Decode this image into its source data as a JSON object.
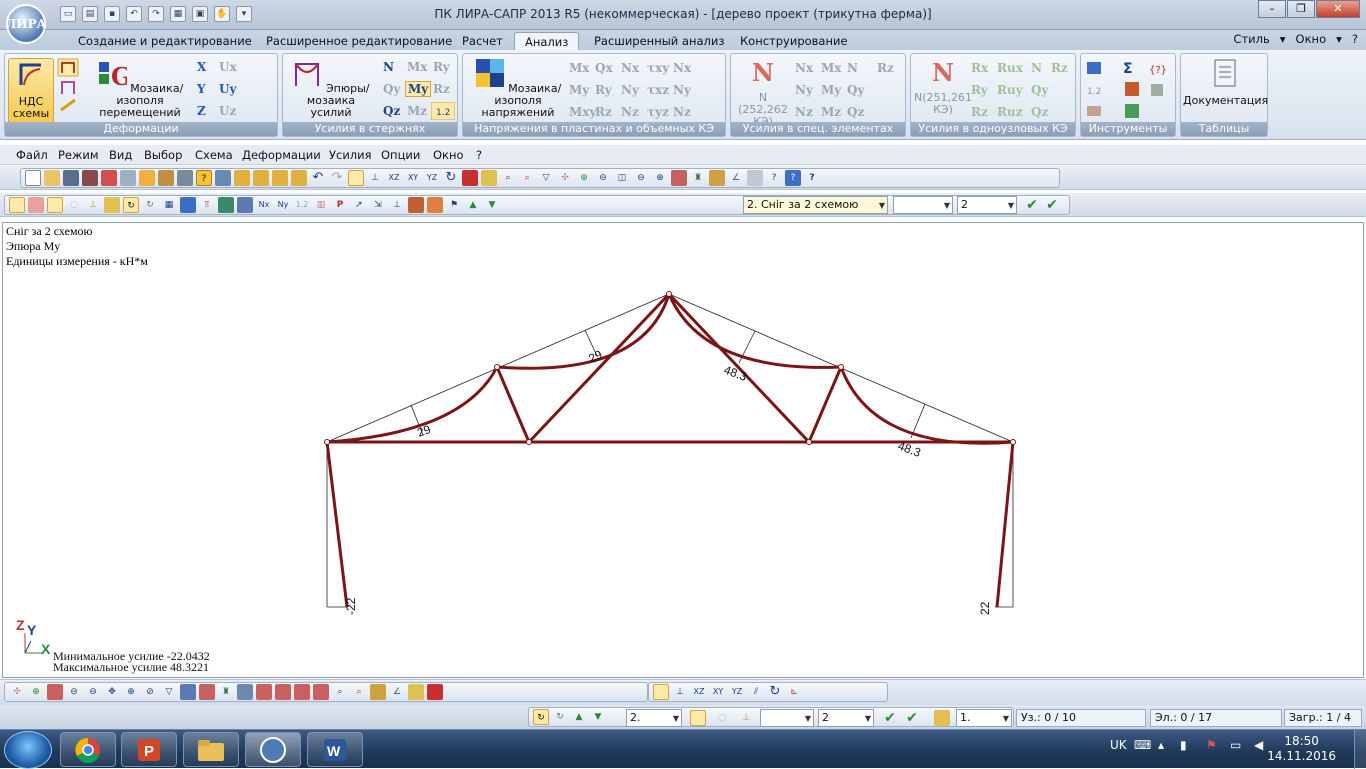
{
  "window": {
    "title": "ПК ЛИРА-САПР  2013 R5 (некоммерческая) - [дерево проект (трикутна ферма)]",
    "logo_text": "ЛИРА"
  },
  "ribbon_tabs": [
    {
      "label": "Создание и редактирование"
    },
    {
      "label": "Расширенное редактирование"
    },
    {
      "label": "Расчет"
    },
    {
      "label": "Анализ"
    },
    {
      "label": "Расширенный анализ"
    },
    {
      "label": "Конструирование"
    }
  ],
  "ribbon_right": {
    "style": "Стиль",
    "window": "Окно",
    "help": "?"
  },
  "ribbon": {
    "groups": [
      {
        "label": "Деформации"
      },
      {
        "label": "Усилия в стержнях"
      },
      {
        "label": "Напряжения в пластинах и объемных КЭ"
      },
      {
        "label": "Усилия в спец. элементах"
      },
      {
        "label": "Усилия в одноузловых КЭ"
      },
      {
        "label": "Инструменты"
      },
      {
        "label": "Таблицы"
      }
    ],
    "buttons": {
      "nds": "НДС схемы",
      "mosaic_disp": "Мозаика/изополя перемещений",
      "diagrams": "Эпюры/мозаика усилий",
      "mosaic_stress": "Мозаика/изополя напряжений",
      "spec_n": "N (252,262 КЭ)",
      "single_n": "N(251,261 КЭ)",
      "docs": "Документация"
    },
    "symbols": {
      "x": "X",
      "y": "Y",
      "z": "Z",
      "ux": "Ux",
      "uy": "Uy",
      "uz": "Uz",
      "n": "N",
      "mx": "Mx",
      "rx": "Ry",
      "qy": "Qy",
      "my": "My",
      "rz": "Rz",
      "qz": "Qz",
      "mz": "Mz",
      "sig": "Σ",
      "nN": "N"
    }
  },
  "menubar": [
    "Файл",
    "Режим",
    "Вид",
    "Выбор",
    "Схема",
    "Деформации",
    "Усилия",
    "Опции",
    "Окно",
    "?"
  ],
  "toolbar2": {
    "load_case": "2. Сніг за 2 схемою",
    "field2": "",
    "field3": "2"
  },
  "canvas": {
    "info": [
      "Сніг за 2 схемою",
      "Эпюра My",
      "Единицы измерения - кН*м"
    ],
    "labels": {
      "l_29a": "29",
      "l_29b": "29",
      "l_48a": "48.3",
      "l_48b": "48.3",
      "l_n22": "-22",
      "l_22": "22"
    },
    "axes": {
      "z": "Z",
      "y": "Y",
      "x": "X"
    },
    "summary": {
      "min": "Минимальное усилие  -22.0432",
      "max": "Максимальное усилие  48.3221"
    }
  },
  "bottom_toolbar": {
    "sel1": "2.",
    "sel2": "2",
    "sel3": "1."
  },
  "status": {
    "nodes": "Уз.: 0 / 10",
    "elements": "Эл.: 0 / 17",
    "load": "Загр.: 1 / 4"
  },
  "taskbar": {
    "lang": "UK",
    "time": "18:50",
    "date": "14.11.2016"
  },
  "colors": {
    "diagram": "#7b1414",
    "accent_tab": "#f1f5fb"
  }
}
